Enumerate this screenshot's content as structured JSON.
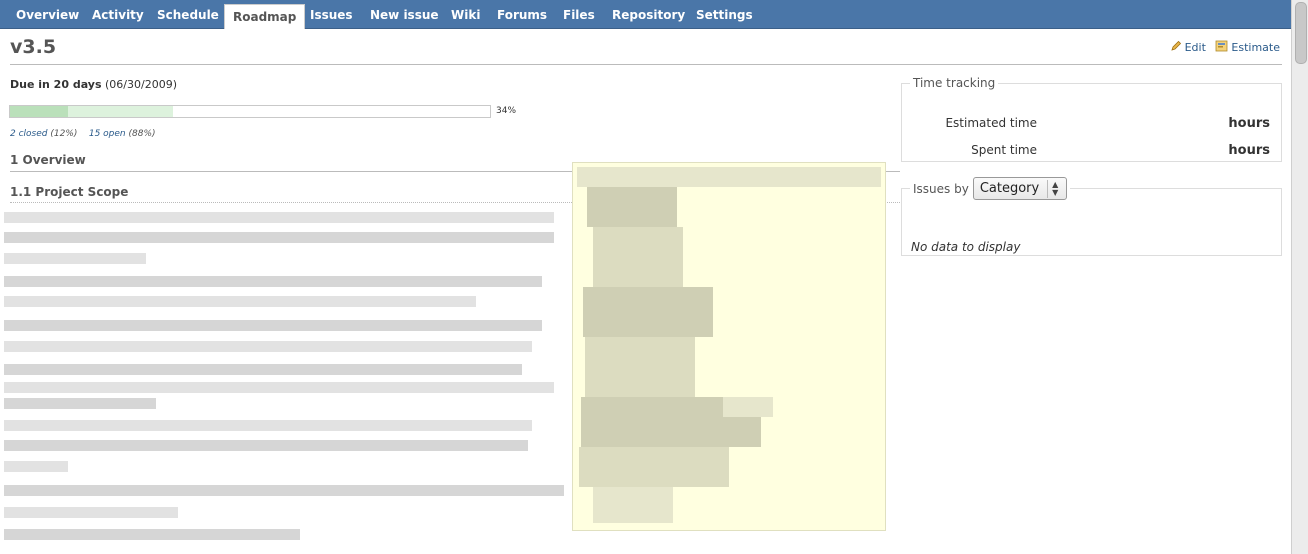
{
  "nav": {
    "tabs": [
      {
        "label": "Overview",
        "active": false
      },
      {
        "label": "Activity",
        "active": false
      },
      {
        "label": "Schedule",
        "active": false
      },
      {
        "label": "Roadmap",
        "active": true
      },
      {
        "label": "Issues",
        "active": false
      },
      {
        "label": "New issue",
        "active": false
      },
      {
        "label": "Wiki",
        "active": false
      },
      {
        "label": "Forums",
        "active": false
      },
      {
        "label": "Files",
        "active": false
      },
      {
        "label": "Repository",
        "active": false
      },
      {
        "label": "Settings",
        "active": false
      }
    ]
  },
  "version": {
    "title": "v3.5",
    "edit_label": "Edit",
    "estimate_label": "Estimate",
    "due_bold": "Due in 20 days",
    "due_date": "(06/30/2009)",
    "progress": {
      "closed_fraction": 0.12,
      "done_fraction": 0.34,
      "percent_label": "34%"
    },
    "closed_link": "2 closed",
    "closed_pct": "(12%)",
    "open_link": "15 open",
    "open_pct": "(88%)"
  },
  "wiki": {
    "h1": "1 Overview",
    "h2": "1.1 Project Scope"
  },
  "time_tracking": {
    "legend": "Time tracking",
    "estimated_label": "Estimated time",
    "estimated_value": "hours",
    "spent_label": "Spent time",
    "spent_value": "hours"
  },
  "issues_by": {
    "legend": "Issues by",
    "selected": "Category",
    "empty": "No data to display"
  },
  "colors": {
    "nav": "#4a76a8",
    "progress_closed": "#bae0ba",
    "progress_done": "#ddf2dd",
    "image_bg": "#ffffe0"
  }
}
